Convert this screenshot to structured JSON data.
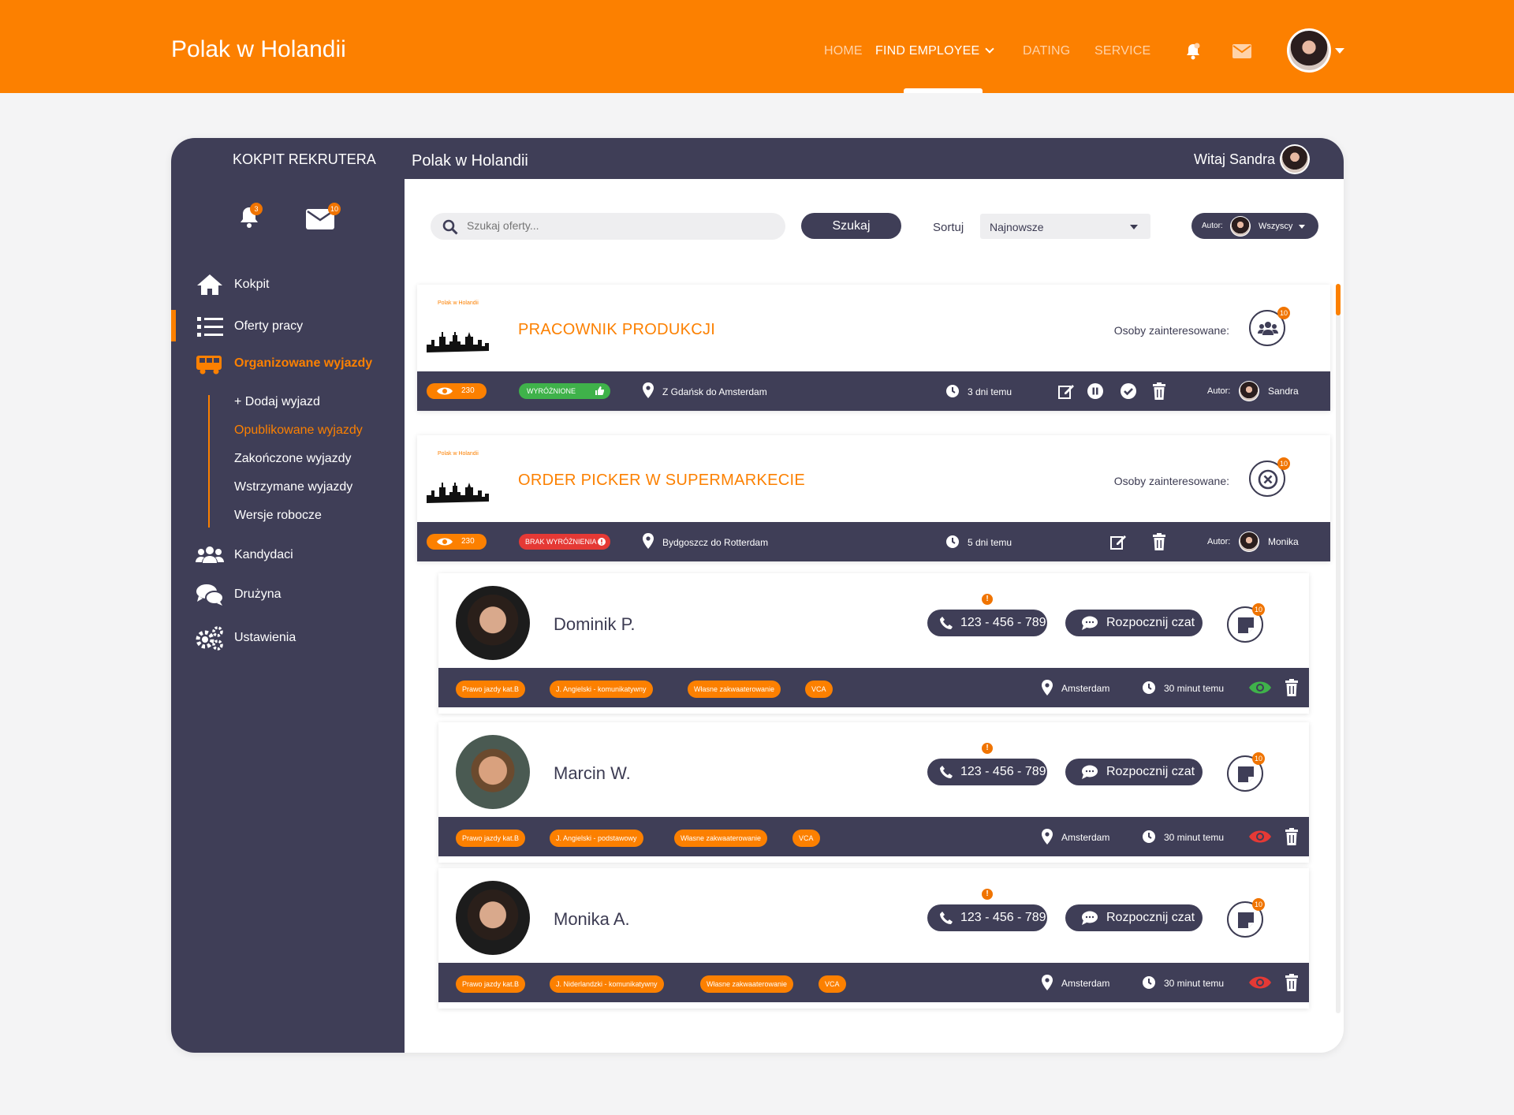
{
  "topbar": {
    "brand": "Polak w Holandii",
    "nav": [
      {
        "label": "HOME"
      },
      {
        "label": "FIND EMPLOYEE"
      },
      {
        "label": "DATING"
      },
      {
        "label": "SERVICE"
      }
    ],
    "icons": [
      "bell-icon",
      "mail-icon"
    ]
  },
  "sidebar": {
    "title": "KOKPIT REKRUTERA",
    "bell_badge": "3",
    "mail_badge": "10",
    "menu": [
      {
        "label": "Kokpit",
        "icon": "home-icon"
      },
      {
        "label": "Oferty pracy",
        "icon": "list-icon"
      },
      {
        "label": "Organizowane wyjazdy",
        "icon": "bus-icon"
      },
      {
        "label": "Kandydaci",
        "icon": "users-icon"
      },
      {
        "label": "Drużyna",
        "icon": "chat-icon"
      },
      {
        "label": "Ustawienia",
        "icon": "gears-icon"
      }
    ],
    "submenu": [
      "+ Dodaj wyjazd",
      "Opublikowane wyjazdy",
      "Zakończone wyjazdy",
      "Wstrzymane wyjazdy",
      "Wersje robocze"
    ]
  },
  "panel": {
    "title": "Polak w Holandii",
    "greeting": "Witaj Sandra"
  },
  "toolbar": {
    "search_placeholder": "Szukaj oferty...",
    "search_button": "Szukaj",
    "sort_label": "Sortuj",
    "sort_value": "Najnowsze",
    "author_label": "Autor:",
    "author_value": "Wszyscy"
  },
  "offers": [
    {
      "logo_title": "Polak w Holandii",
      "title": "PRACOWNIK PRODUKCJI",
      "interested_label": "Osoby zainteresowane:",
      "interested_count": "10",
      "views": "230",
      "status": "WYRÓŻNIONE",
      "route": "Z Gdańsk do Amsterdam",
      "time": "3 dni temu",
      "author_label": "Autor:",
      "author": "Sandra"
    },
    {
      "logo_title": "Polak w Holandii",
      "title": "ORDER PICKER W SUPERMARKECIE",
      "interested_label": "Osoby zainteresowane:",
      "interested_count": "10",
      "views": "230",
      "status": "BRAK WYRÓŻNIENIA",
      "route": "Bydgoszcz do Rotterdam",
      "time": "5 dni temu",
      "author_label": "Autor:",
      "author": "Monika"
    }
  ],
  "candidates": [
    {
      "name": "Dominik P.",
      "phone": "123 - 456 - 789",
      "chat": "Rozpocznij czat",
      "notes_count": "10",
      "tags": [
        "Prawo jazdy kat.B",
        "J. Angielski - komunikatywny",
        "Własne zakwaaterowanie",
        "VCA"
      ],
      "location": "Amsterdam",
      "time": "30 minut temu",
      "visibility_color": "#3fb24a"
    },
    {
      "name": "Marcin W.",
      "phone": "123 - 456 - 789",
      "chat": "Rozpocznij czat",
      "notes_count": "10",
      "tags": [
        "Prawo jazdy kat.B",
        "J. Angielski - podstawowy",
        "Własne zakwaaterowanie",
        "VCA"
      ],
      "location": "Amsterdam",
      "time": "30 minut temu",
      "visibility_color": "#e53935"
    },
    {
      "name": "Monika A.",
      "phone": "123 - 456 - 789",
      "chat": "Rozpocznij czat",
      "notes_count": "10",
      "tags": [
        "Prawo jazdy kat.B",
        "J. Niderlandzki - komunikatywny",
        "Własne zakwaaterowanie",
        "VCA"
      ],
      "location": "Amsterdam",
      "time": "30 minut temu",
      "visibility_color": "#e53935"
    }
  ],
  "colors": {
    "accent": "#fc8000",
    "dark": "#3f3e57",
    "ok": "#3fb24a",
    "bad": "#e53935"
  }
}
